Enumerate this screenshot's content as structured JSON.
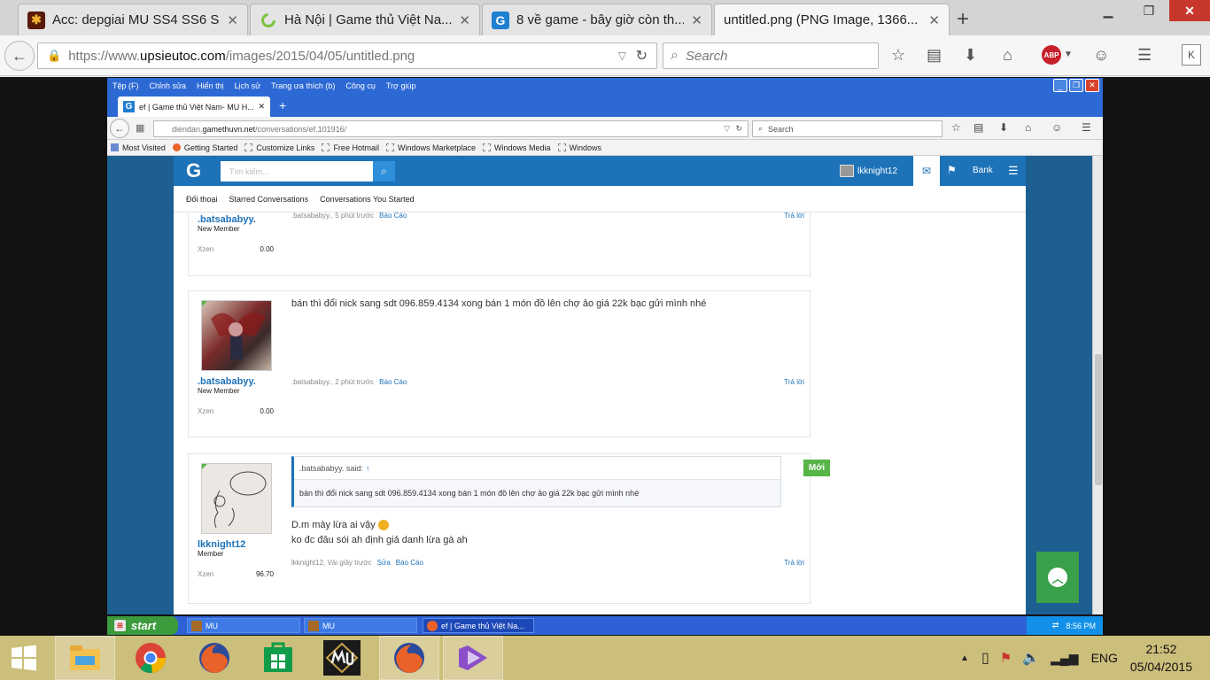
{
  "outer_browser": {
    "tabs": [
      {
        "title": "Acc: depgiai MU SS4 SS6 S...",
        "icon": "mu-icon"
      },
      {
        "title": "Hà Nội | Game thủ Việt Na...",
        "icon": "loading-spinner-icon"
      },
      {
        "title": "8 về game - bây giờ còn th...",
        "icon": "g-logo-icon"
      },
      {
        "title": "untitled.png (PNG Image, 1366...",
        "icon": "none"
      }
    ],
    "url_prefix": "https://www.",
    "url_domain": "upsieutoc.com",
    "url_path": "/images/2015/04/05/untitled.png",
    "search_placeholder": "Search",
    "abp_label": "ABP"
  },
  "inner_browser": {
    "menu": [
      "Tệp (F)",
      "Chỉnh sửa",
      "Hiển thị",
      "Lịch sử",
      "Trang ưa thích (b)",
      "Công cụ",
      "Trợ giúp"
    ],
    "tab_title": "ef | Game thủ Việt Nam- MU H...",
    "url_prefix": "diendan.",
    "url_domain": "gamethuvn.net",
    "url_path": "/conversations/ef.101916/",
    "search_placeholder": "Search",
    "bookmarks": [
      "Most Visited",
      "Getting Started",
      "Customize Links",
      "Free Hotmail",
      "Windows Marketplace",
      "Windows Media",
      "Windows"
    ]
  },
  "forum": {
    "search_placeholder": "Tìm kiếm...",
    "username": "lkknight12",
    "bank_label": "Bank",
    "subnav": [
      "Đối thoại",
      "Starred Conversations",
      "Conversations You Started"
    ],
    "posts": [
      {
        "username": ".batsababyy.",
        "user_title": "New Member",
        "stat_label": "Xzen",
        "stat_value": "0.00",
        "meta": ".batsababyy., 5 phút trước",
        "report": "Báo Cáo",
        "reply": "Trả lời"
      },
      {
        "username": ".batsababyy.",
        "user_title": "New Member",
        "stat_label": "Xzen",
        "stat_value": "0.00",
        "message": "bán thì đổi nick sang sdt 096.859.4134 xong bán 1 món đồ lên chợ ảo giá 22k bạc gửi mình nhé",
        "meta": ".batsababyy., 2 phút trước",
        "report": "Báo Cáo",
        "reply": "Trả lời"
      },
      {
        "username": "lkknight12",
        "user_title": "Member",
        "stat_label": "Xzen",
        "stat_value": "96.70",
        "quote_header": ".batsababyy. said:",
        "quote_arrow": "↑",
        "quote_body": "bán thì đổi nick sang sdt 096.859.4134 xong bán 1 món đồ lên chợ ảo giá 22k bạc gửi mình nhé",
        "new_badge": "Mới",
        "message_line1": "D.m mày lừa ai vậy",
        "message_line2": "ko đc đâu sói ah  định giả danh lừa gà ah",
        "meta": "lkknight12, Vài giây trước",
        "edit": "Sửa",
        "report": "Báo Cáo",
        "reply": "Trả lời"
      }
    ]
  },
  "xp_taskbar": {
    "start_label": "start",
    "tasks": [
      "MU",
      "MU",
      "ef | Game thủ Việt Na..."
    ],
    "clock": "8:56 PM"
  },
  "win8_taskbar": {
    "language": "ENG",
    "time": "21:52",
    "date": "05/04/2015"
  }
}
